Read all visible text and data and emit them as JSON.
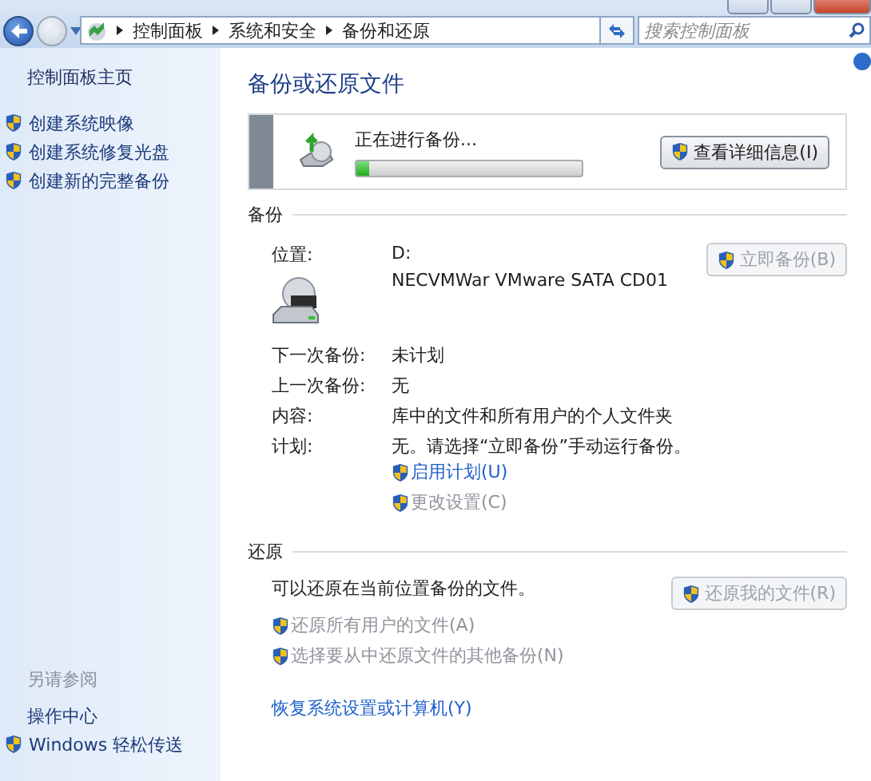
{
  "address_bar": {
    "breadcrumbs": [
      "控制面板",
      "系统和安全",
      "备份和还原"
    ],
    "search": {
      "placeholder": "搜索控制面板"
    }
  },
  "sidebar": {
    "home": "控制面板主页",
    "tasks": [
      {
        "label": "创建系统映像",
        "shield": true
      },
      {
        "label": "创建系统修复光盘",
        "shield": true
      },
      {
        "label": "创建新的完整备份",
        "shield": true
      }
    ],
    "see_also": {
      "title": "另请参阅",
      "items": [
        {
          "label": "操作中心",
          "shield": false
        },
        {
          "label": "Windows 轻松传送",
          "shield": true
        }
      ]
    }
  },
  "main": {
    "title": "备份或还原文件",
    "progress": {
      "label": "正在进行备份...",
      "level": 0.06,
      "button": "查看详细信息(I)"
    },
    "backup": {
      "heading": "备份",
      "location_label": "位置:",
      "location_lines": [
        "D:",
        "NECVMWar VMware SATA CD01"
      ],
      "button": {
        "label": "立即备份(B)",
        "disabled": true
      },
      "details": [
        {
          "label": "下一次备份:",
          "value": "未计划"
        },
        {
          "label": "上一次备份:",
          "value": "无"
        },
        {
          "label": "内容:",
          "value": "库中的文件和所有用户的个人文件夹"
        },
        {
          "label": "计划:",
          "value": "无。请选择“立即备份”手动运行备份。"
        }
      ],
      "links": [
        {
          "label": "启用计划(U)",
          "disabled": false
        },
        {
          "label": "更改设置(C)",
          "disabled": true
        }
      ]
    },
    "restore": {
      "heading": "还原",
      "text": "可以还原在当前位置备份的文件。",
      "button": {
        "label": "还原我的文件(R)",
        "disabled": true
      },
      "links": [
        {
          "label": "还原所有用户的文件(A)",
          "disabled": true
        },
        {
          "label": "选择要从中还原文件的其他备份(N)",
          "disabled": true
        }
      ],
      "recover_link": "恢复系统设置或计算机(Y)"
    }
  }
}
